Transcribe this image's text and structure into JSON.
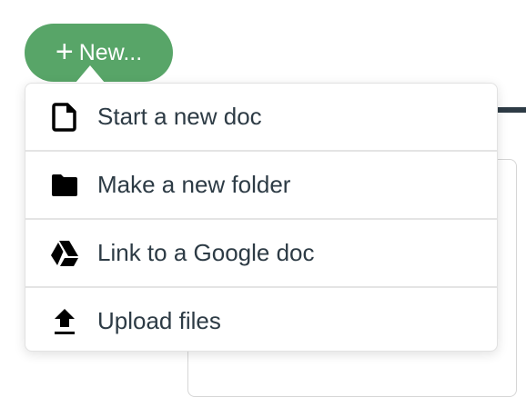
{
  "new_button": {
    "label": "New..."
  },
  "menu": {
    "items": [
      {
        "label": "Start a new doc",
        "icon": "document-icon"
      },
      {
        "label": "Make a new folder",
        "icon": "folder-icon"
      },
      {
        "label": "Link to a Google doc",
        "icon": "google-drive-icon"
      },
      {
        "label": "Upload files",
        "icon": "upload-icon"
      }
    ]
  },
  "colors": {
    "accent": "#58a568",
    "text": "#2d3b45"
  }
}
